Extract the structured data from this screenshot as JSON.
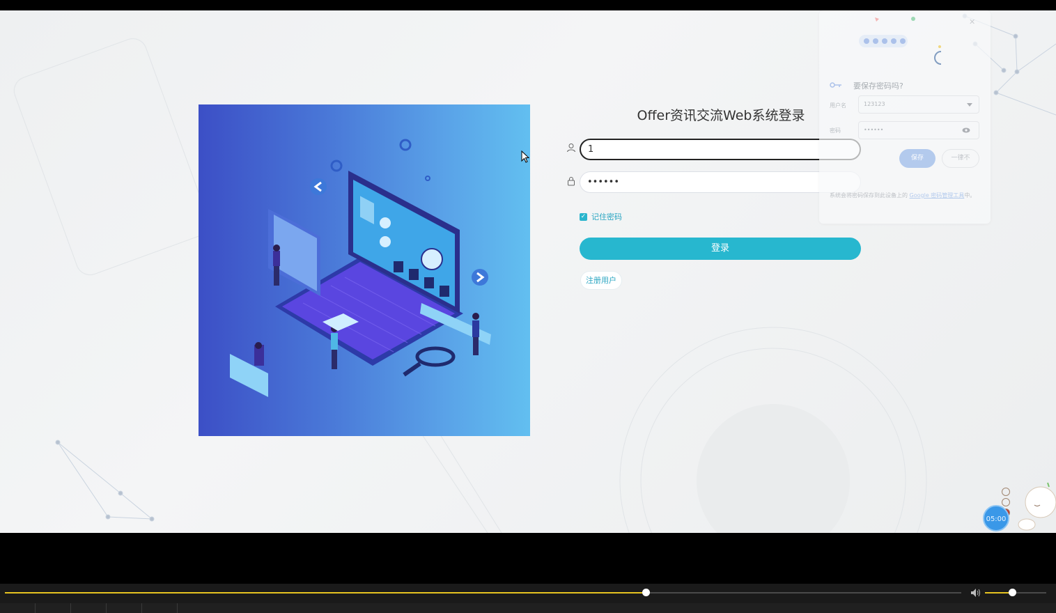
{
  "login": {
    "title": "Offer资讯交流Web系统登录",
    "username_value": "1",
    "password_value": "••••••",
    "remember_label": "记住密码",
    "remember_checked": true,
    "login_button": "登录",
    "register_button": "注册用户"
  },
  "password_popup": {
    "title": "要保存密码吗?",
    "username_label": "用户名",
    "username_value": "123123",
    "password_label": "密码",
    "password_value": "••••••",
    "save_button": "保存",
    "later_button": "一律不",
    "note_prefix": "系统会将密码保存到此设备上的 ",
    "note_link": "Google 密码管理工具",
    "note_suffix": "中。"
  },
  "timer": "05:00",
  "player": {
    "progress": 0.67,
    "volume": 0.44,
    "accent": "#e7c320"
  },
  "colors": {
    "primary": "#27b7cf",
    "hero_from": "#3c4fc6",
    "hero_to": "#62bff0"
  }
}
